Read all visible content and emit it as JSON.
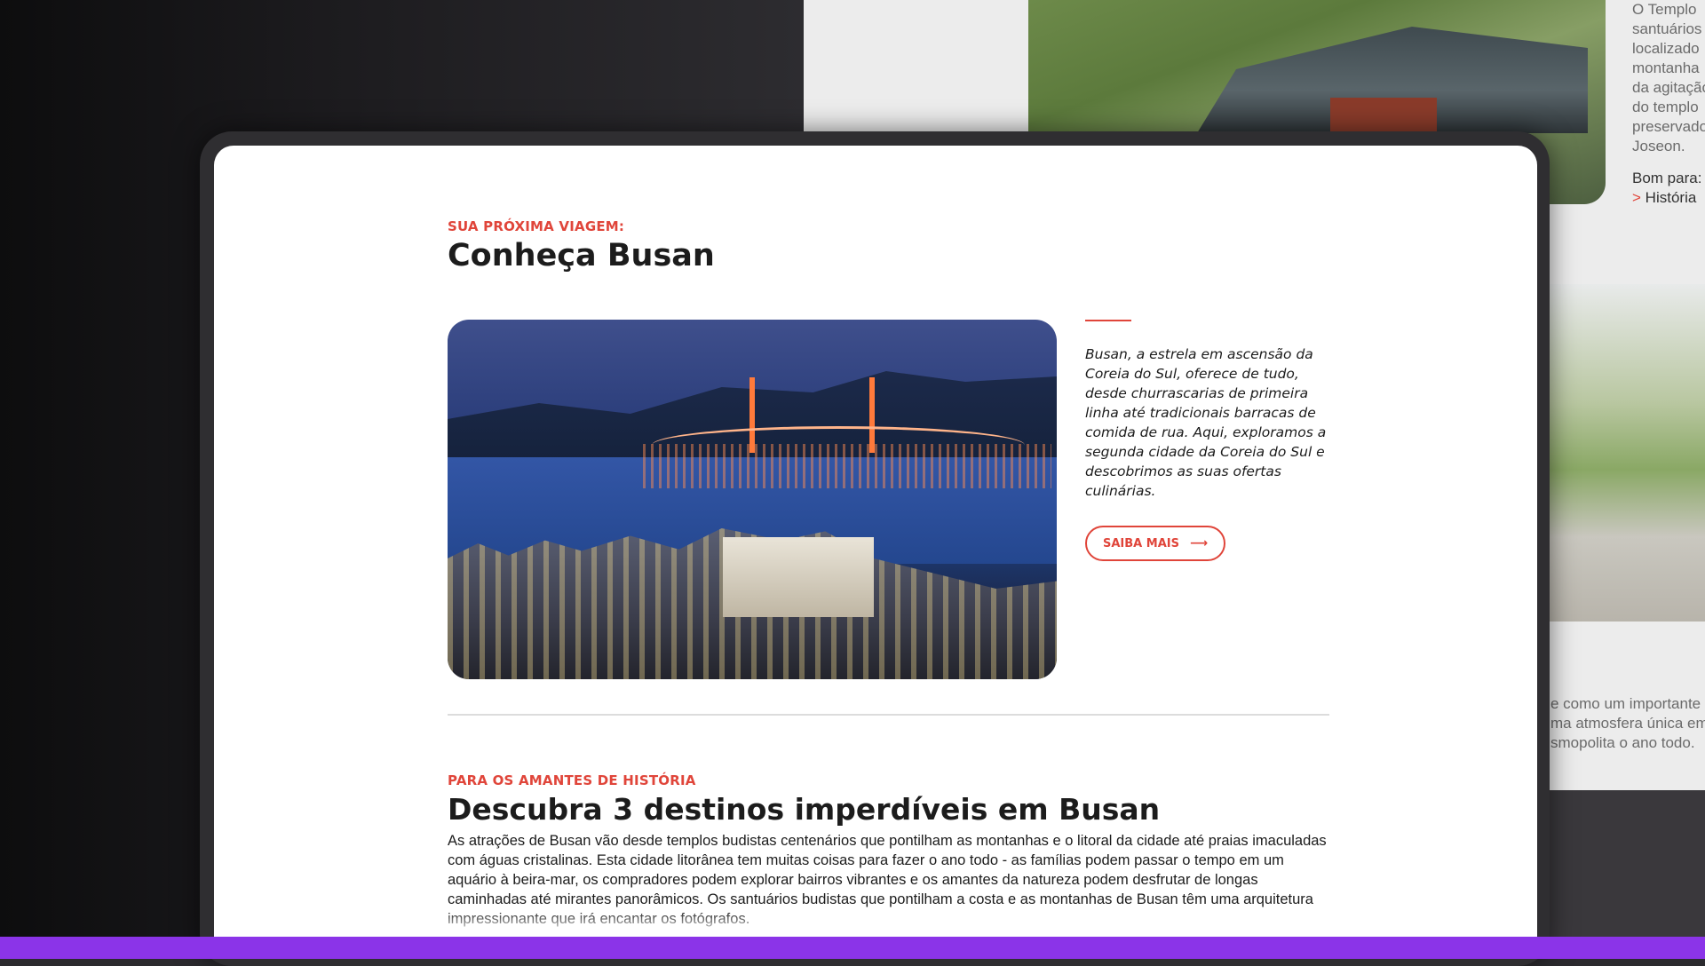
{
  "background_page": {
    "side_text_top": [
      "O Templo",
      "santuários",
      "localizado",
      "montanha",
      "da agitação",
      "do templo",
      "preservado",
      "Joseon."
    ],
    "good_for_label": "Bom para:",
    "good_for_marker": ">",
    "good_for_item": "História",
    "side_text_bottom": [
      "e como um importante",
      "ma atmosfera única em",
      "smopolita o ano todo."
    ]
  },
  "card": {
    "eyebrow": "SUA PRÓXIMA VIAGEM:",
    "title": "Conheça Busan",
    "hero_image_alt": "Busan harbor bridge at night",
    "description": "Busan, a estrela em ascensão da Coreia do Sul, oferece de tudo, desde churrascarias de primeira linha até tradicionais barracas de comida de rua. Aqui, exploramos a segunda cidade da Coreia do Sul e descobrimos as suas ofertas culinárias.",
    "button_label": "SAIBA MAIS",
    "button_icon": "arrow-right-icon"
  },
  "section2": {
    "eyebrow": "PARA OS AMANTES DE HISTÓRIA",
    "title": "Descubra 3 destinos imperdíveis em Busan",
    "body": "As atrações de Busan vão desde templos budistas centenários que pontilham as montanhas e o litoral da cidade até praias imaculadas com águas cristalinas. Esta cidade litorânea tem muitas coisas para fazer o ano todo - as famílias podem passar o tempo em um aquário à beira-mar, os compradores podem explorar bairros vibrantes e os amantes da natureza podem desfrutar de longas caminhadas até mirantes panorâmicos. Os santuários budistas que pontilham a costa e as montanhas de Busan têm uma arquitetura impressionante que irá encantar os fotógrafos."
  },
  "colors": {
    "accent": "#e0453a",
    "bottom_bar": "#8b34e8",
    "text": "#1c1c1c"
  }
}
